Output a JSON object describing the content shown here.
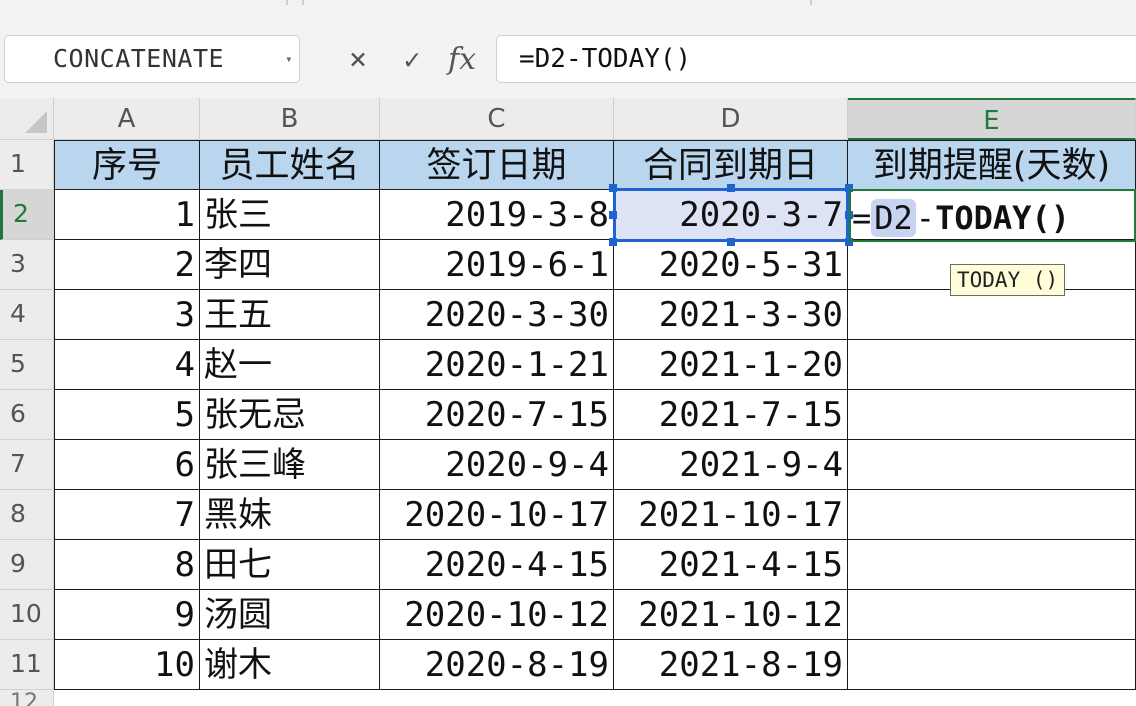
{
  "name_box": {
    "value": "CONCATENATE",
    "dropdown_icon": "caret-down-icon"
  },
  "formula_bar": {
    "cancel_icon": "×",
    "enter_icon": "✓",
    "fx_label": "fx",
    "formula": "=D2-TODAY()"
  },
  "columns": [
    "A",
    "B",
    "C",
    "D",
    "E"
  ],
  "row_numbers": [
    "1",
    "2",
    "3",
    "4",
    "5",
    "6",
    "7",
    "8",
    "9",
    "10",
    "11",
    "12"
  ],
  "headers": [
    "序号",
    "员工姓名",
    "签订日期",
    "合同到期日",
    "到期提醒(天数)"
  ],
  "rows": [
    {
      "no": "1",
      "name": "张三",
      "sign": "2019-3-8",
      "due": "2020-3-7"
    },
    {
      "no": "2",
      "name": "李四",
      "sign": "2019-6-1",
      "due": "2020-5-31"
    },
    {
      "no": "3",
      "name": "王五",
      "sign": "2020-3-30",
      "due": "2021-3-30"
    },
    {
      "no": "4",
      "name": "赵一",
      "sign": "2020-1-21",
      "due": "2021-1-20"
    },
    {
      "no": "5",
      "name": "张无忌",
      "sign": "2020-7-15",
      "due": "2021-7-15"
    },
    {
      "no": "6",
      "name": "张三峰",
      "sign": "2020-9-4",
      "due": "2021-9-4"
    },
    {
      "no": "7",
      "name": "黑妹",
      "sign": "2020-10-17",
      "due": "2021-10-17"
    },
    {
      "no": "8",
      "name": "田七",
      "sign": "2020-4-15",
      "due": "2021-4-15"
    },
    {
      "no": "9",
      "name": "汤圆",
      "sign": "2020-10-12",
      "due": "2021-10-12"
    },
    {
      "no": "10",
      "name": "谢木",
      "sign": "2020-8-19",
      "due": "2021-8-19"
    }
  ],
  "editing": {
    "eq": "=",
    "ref": "D2",
    "op": "-",
    "func": "TODAY()",
    "tooltip": "TODAY ()"
  },
  "colors": {
    "header_fill": "#b9d6ee",
    "active_green": "#1e7b3c",
    "reference_blue": "#1f63d0",
    "reference_fill": "#dde3f4",
    "tooltip_fill": "#fffed8"
  }
}
